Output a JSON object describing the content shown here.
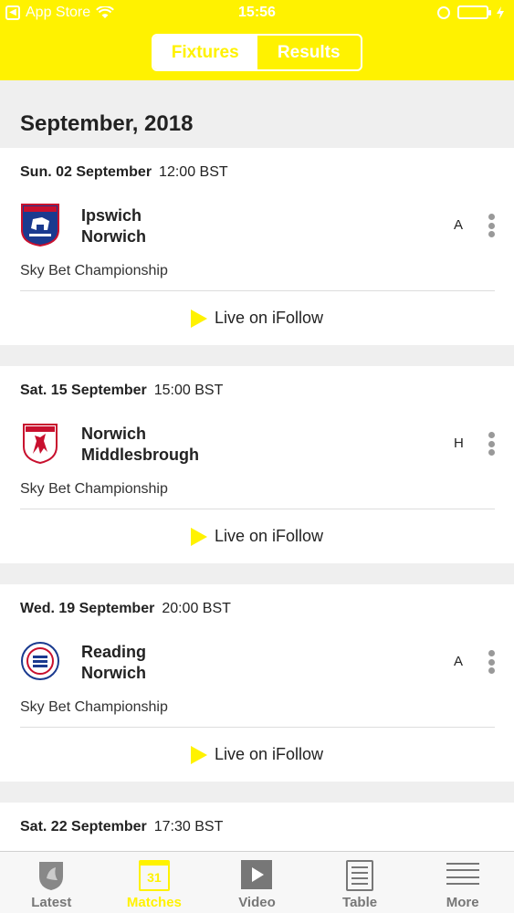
{
  "status_bar": {
    "back_app": "App Store",
    "time": "15:56"
  },
  "segmented": {
    "fixtures": "Fixtures",
    "results": "Results"
  },
  "month_title": "September, 2018",
  "fixtures": [
    {
      "date": "Sun. 02 September",
      "time": "12:00 BST",
      "home": "Ipswich",
      "away": "Norwich",
      "venue": "A",
      "competition": "Sky Bet Championship",
      "live": "Live on iFollow",
      "crest": "ipswich-crest-icon"
    },
    {
      "date": "Sat. 15 September",
      "time": "15:00 BST",
      "home": "Norwich",
      "away": "Middlesbrough",
      "venue": "H",
      "competition": "Sky Bet Championship",
      "live": "Live on iFollow",
      "crest": "middlesbrough-crest-icon"
    },
    {
      "date": "Wed. 19 September",
      "time": "20:00 BST",
      "home": "Reading",
      "away": "Norwich",
      "venue": "A",
      "competition": "Sky Bet Championship",
      "live": "Live on iFollow",
      "crest": "reading-crest-icon"
    },
    {
      "date": "Sat. 22 September",
      "time": "17:30 BST"
    }
  ],
  "tabs": [
    {
      "label": "Latest"
    },
    {
      "label": "Matches",
      "calendar_day": "31"
    },
    {
      "label": "Video"
    },
    {
      "label": "Table"
    },
    {
      "label": "More"
    }
  ],
  "colors": {
    "accent": "#fff200",
    "background": "#efefef",
    "inactive": "#777777"
  }
}
